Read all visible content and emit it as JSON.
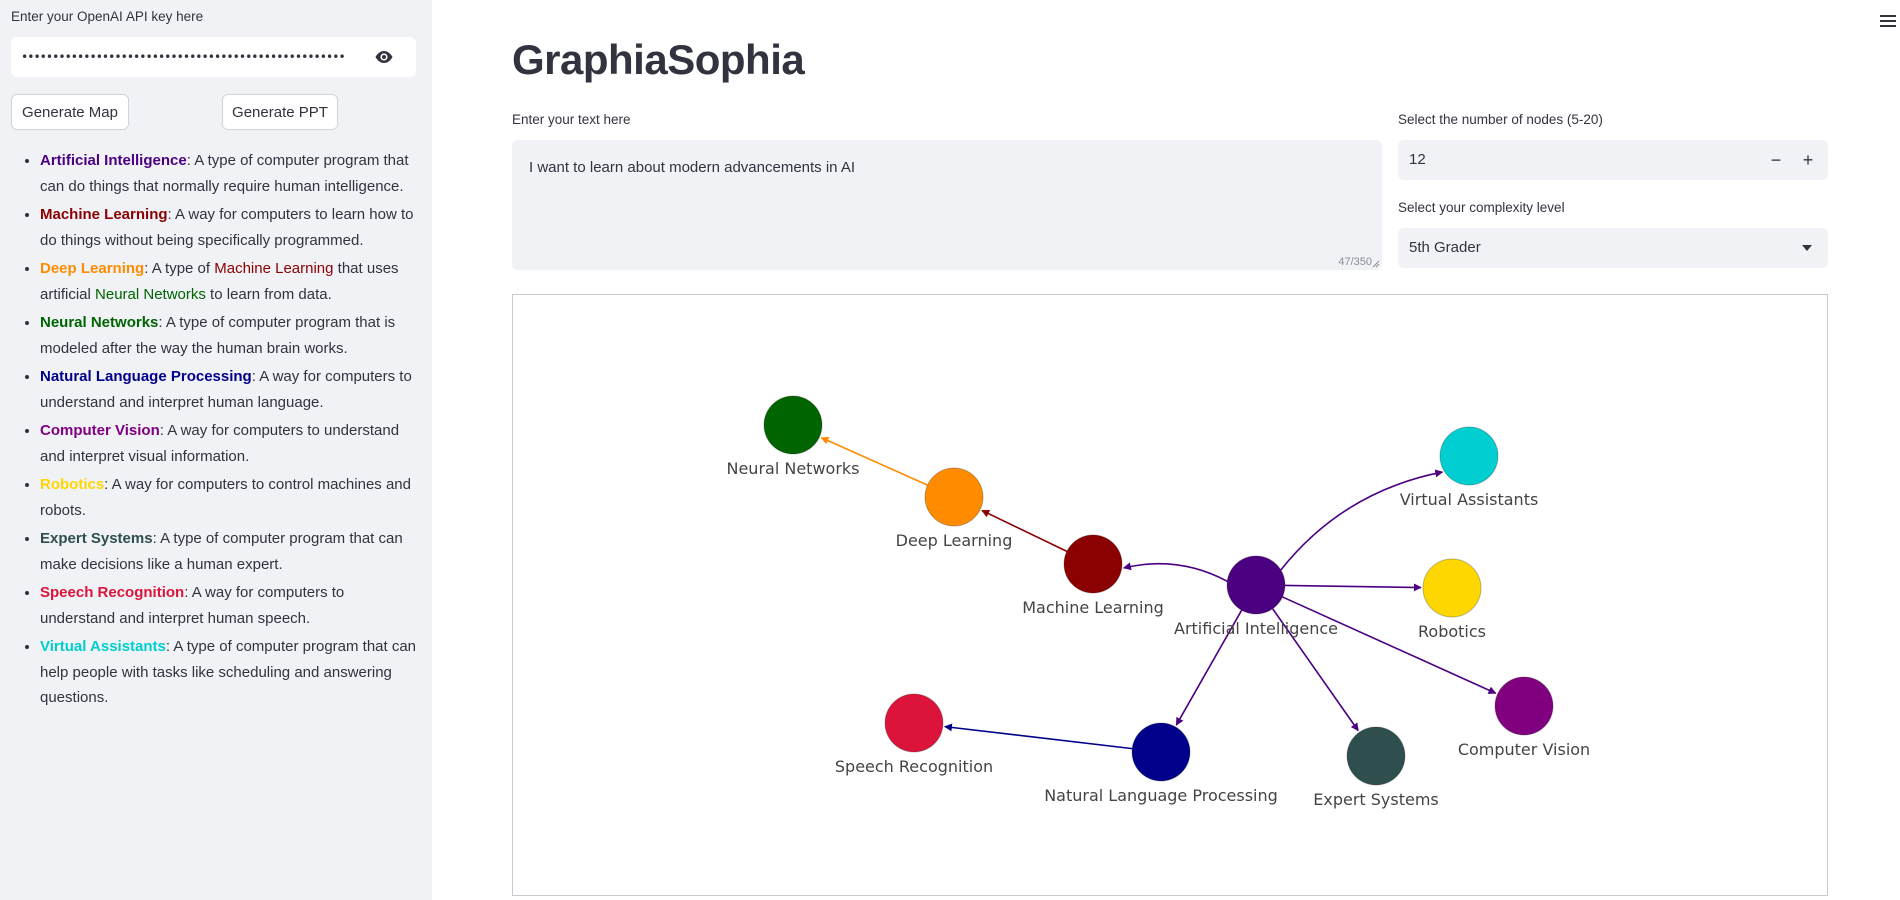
{
  "sidebar": {
    "api_label": "Enter your OpenAI API key here",
    "api_key_masked": "••••••••••••••••••••••••••••••••••••••••••••••••••••",
    "eye_icon": "eye-icon",
    "generate_map_label": "Generate Map",
    "generate_ppt_label": "Generate PPT",
    "definitions": [
      {
        "term": "Artificial Intelligence",
        "color": "#4b0082",
        "segments": [
          {
            "text": ": A type of computer program that can do things that normally require human intelligence."
          }
        ]
      },
      {
        "term": "Machine Learning",
        "color": "#8b0000",
        "segments": [
          {
            "text": ": A way for computers to learn how to do things without being specifically programmed."
          }
        ]
      },
      {
        "term": "Deep Learning",
        "color": "#ff8c00",
        "segments": [
          {
            "text": ": A type of "
          },
          {
            "text": "Machine Learning",
            "color": "#8b0000"
          },
          {
            "text": " that uses artificial "
          },
          {
            "text": "Neural Networks",
            "color": "#006400"
          },
          {
            "text": " to learn from data."
          }
        ]
      },
      {
        "term": "Neural Networks",
        "color": "#006400",
        "segments": [
          {
            "text": ": A type of computer program that is modeled after the way the human brain works."
          }
        ]
      },
      {
        "term": "Natural Language Processing",
        "color": "#00008b",
        "segments": [
          {
            "text": ": A way for computers to understand and interpret human language."
          }
        ]
      },
      {
        "term": "Computer Vision",
        "color": "#800080",
        "segments": [
          {
            "text": ": A way for computers to understand and interpret visual information."
          }
        ]
      },
      {
        "term": "Robotics",
        "color": "#ffd700",
        "segments": [
          {
            "text": ": A way for computers to control machines and robots."
          }
        ]
      },
      {
        "term": "Expert Systems",
        "color": "#2f4f4f",
        "segments": [
          {
            "text": ": A type of computer program that can make decisions like a human expert."
          }
        ]
      },
      {
        "term": "Speech Recognition",
        "color": "#dc143c",
        "segments": [
          {
            "text": ": A way for computers to understand and interpret human speech."
          }
        ]
      },
      {
        "term": "Virtual Assistants",
        "color": "#00ced1",
        "segments": [
          {
            "text": ": A type of computer program that can help people with tasks like scheduling and answering questions."
          }
        ]
      }
    ]
  },
  "main": {
    "title": "GraphiaSophia",
    "text_label": "Enter your text here",
    "text_value": "I want to learn about modern advancements in AI",
    "char_count": "47/350",
    "nodes_label": "Select the number of nodes (5-20)",
    "nodes_value": "12",
    "minus_label": "−",
    "plus_label": "+",
    "complexity_label": "Select your complexity level",
    "complexity_value": "5th Grader",
    "menu_icon": "hamburger-menu-icon"
  },
  "graph": {
    "nodes": [
      {
        "id": "ai",
        "label": "Artificial Intelligence",
        "color": "#4b0082"
      },
      {
        "id": "ml",
        "label": "Machine Learning",
        "color": "#8b0000"
      },
      {
        "id": "dl",
        "label": "Deep Learning",
        "color": "#ff8c00"
      },
      {
        "id": "nn",
        "label": "Neural Networks",
        "color": "#006400"
      },
      {
        "id": "nlp",
        "label": "Natural Language Processing",
        "color": "#00008b"
      },
      {
        "id": "cv",
        "label": "Computer Vision",
        "color": "#800080"
      },
      {
        "id": "rob",
        "label": "Robotics",
        "color": "#ffd700"
      },
      {
        "id": "es",
        "label": "Expert Systems",
        "color": "#2f4f4f"
      },
      {
        "id": "sr",
        "label": "Speech Recognition",
        "color": "#dc143c"
      },
      {
        "id": "va",
        "label": "Virtual Assistants",
        "color": "#00ced1"
      }
    ],
    "edges": [
      {
        "from": "ai",
        "to": "ml"
      },
      {
        "from": "ai",
        "to": "va"
      },
      {
        "from": "ai",
        "to": "rob"
      },
      {
        "from": "ai",
        "to": "cv"
      },
      {
        "from": "ai",
        "to": "es"
      },
      {
        "from": "ai",
        "to": "nlp"
      },
      {
        "from": "ml",
        "to": "dl"
      },
      {
        "from": "dl",
        "to": "nn"
      },
      {
        "from": "nlp",
        "to": "sr"
      }
    ]
  }
}
